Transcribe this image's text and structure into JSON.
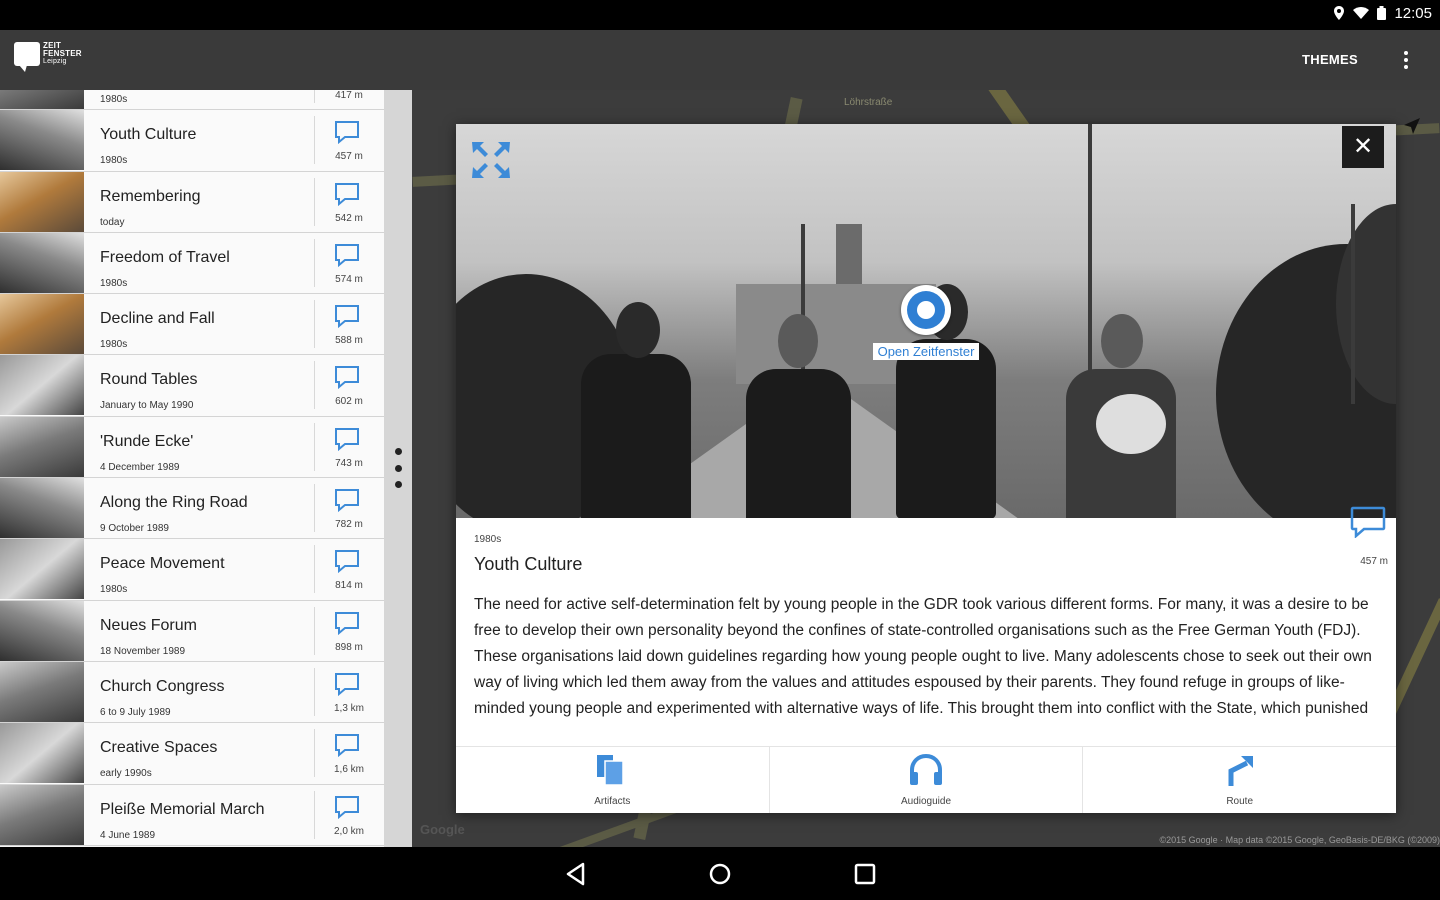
{
  "status": {
    "time": "12:05"
  },
  "appbar": {
    "logo_line1": "ZEIT",
    "logo_line2": "FENSTER",
    "logo_line3": "Leipzig",
    "themes_label": "THEMES"
  },
  "list": [
    {
      "title": "",
      "sub": "1980s",
      "dist": "417 m"
    },
    {
      "title": "Youth Culture",
      "sub": "1980s",
      "dist": "457 m"
    },
    {
      "title": "Remembering",
      "sub": "today",
      "dist": "542 m"
    },
    {
      "title": "Freedom of Travel",
      "sub": "1980s",
      "dist": "574 m"
    },
    {
      "title": "Decline and Fall",
      "sub": "1980s",
      "dist": "588 m"
    },
    {
      "title": "Round Tables",
      "sub": "January to May 1990",
      "dist": "602 m"
    },
    {
      "title": "'Runde Ecke'",
      "sub": "4 December 1989",
      "dist": "743 m"
    },
    {
      "title": "Along the Ring Road",
      "sub": "9 October 1989",
      "dist": "782 m"
    },
    {
      "title": "Peace Movement",
      "sub": "1980s",
      "dist": "814 m"
    },
    {
      "title": "Neues Forum",
      "sub": "18 November 1989",
      "dist": "898 m"
    },
    {
      "title": "Church Congress",
      "sub": "6 to 9 July 1989",
      "dist": "1,3 km"
    },
    {
      "title": "Creative Spaces",
      "sub": "early 1990s",
      "dist": "1,6 km"
    },
    {
      "title": "Pleiße Memorial March",
      "sub": "4 June 1989",
      "dist": "2,0 km"
    }
  ],
  "map": {
    "street_label": "Löhrstraße",
    "google": "Google",
    "copyright": "©2015 Google · Map data ©2015 Google, GeoBasis-DE/BKG (©2009)"
  },
  "dialog": {
    "open_label": "Open Zeitfenster",
    "close_symbol": "✕",
    "era": "1980s",
    "title": "Youth Culture",
    "dist": "457 m",
    "description": "The need for active self-determination felt by young people in the GDR took various different forms. For many, it was a desire to be free to develop their own personality beyond the confines of state-controlled organisations such as the Free German Youth (FDJ). These organisations laid down guidelines regarding how young people ought to live. Many adolescents chose to seek out their own way of living which led them away from the values and attitudes espoused by their parents. They found refuge in groups of like-minded young people and experimented with alternative ways of life. This brought them into conflict with the State, which punished",
    "actions": [
      {
        "label": "Artifacts",
        "icon": "artifacts-icon"
      },
      {
        "label": "Audioguide",
        "icon": "headphones-icon"
      },
      {
        "label": "Route",
        "icon": "route-icon"
      }
    ]
  },
  "colors": {
    "accent": "#2f7fd3",
    "appbar": "#3a3a3a",
    "statusbar": "#000000"
  }
}
